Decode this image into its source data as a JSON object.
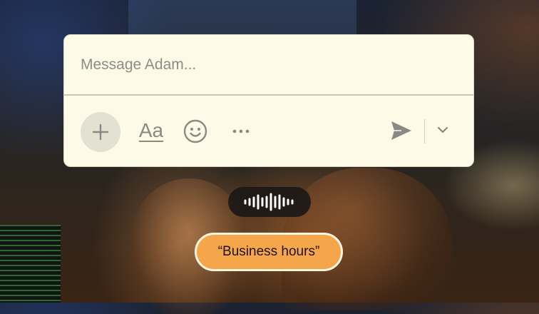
{
  "composer": {
    "placeholder": "Message Adam...",
    "format_label": "Aa"
  },
  "toolbar": {
    "icons": [
      "plus-icon",
      "text-format-icon",
      "smiley-icon",
      "ellipsis-icon",
      "send-icon",
      "chevron-down-icon"
    ]
  },
  "voice": {
    "icon": "waveform-icon",
    "transcript": "“Business hours”"
  },
  "colors": {
    "composer_bg": "#fdfbe8",
    "icon_gray": "#8a8a84",
    "transcript_bg": "#f5a54a",
    "voice_pill_bg": "#1c1816"
  }
}
